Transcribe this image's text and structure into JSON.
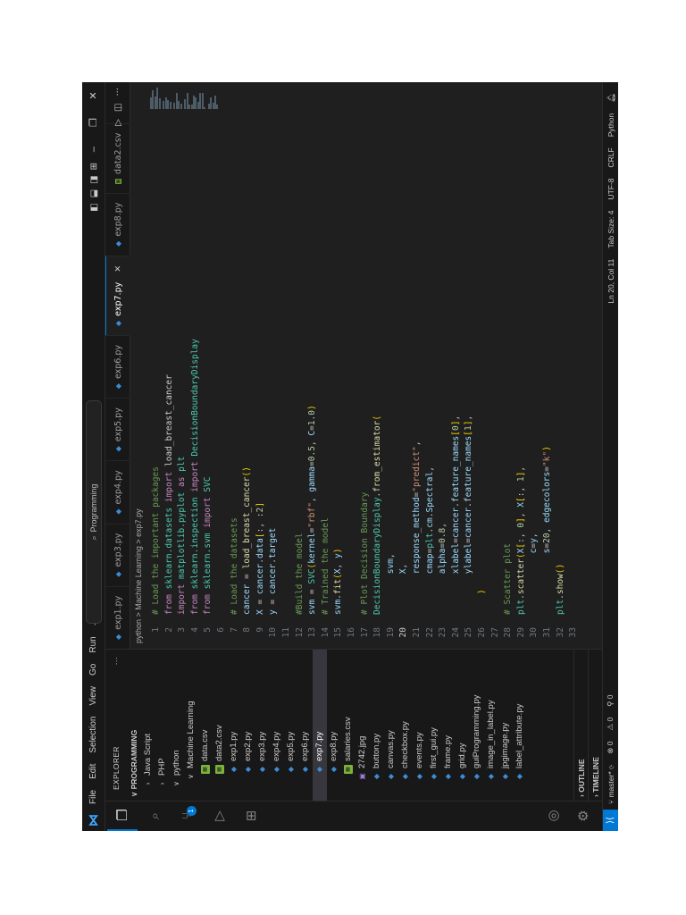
{
  "app": {
    "menu": [
      "File",
      "Edit",
      "Selection",
      "View",
      "Go",
      "Run",
      "..."
    ],
    "search_text": "Programming",
    "colors": {
      "accent": "#0078d4",
      "background": "#1f1f1f",
      "chrome": "#181818"
    }
  },
  "activity_bar": {
    "icons": [
      "explorer-icon",
      "search-icon",
      "source-control-icon",
      "extensions-icon",
      "remote-explorer-icon",
      "accounts-icon",
      "settings-gear-icon"
    ],
    "scm_badge": "1"
  },
  "sidebar": {
    "header": "EXPLORER",
    "folder": "PROGRAMMING",
    "items": [
      {
        "label": "Java Script",
        "type": "folder-closed",
        "indent": 1
      },
      {
        "label": "PHP",
        "type": "folder-closed",
        "indent": 1
      },
      {
        "label": "python",
        "type": "folder-open",
        "indent": 1
      },
      {
        "label": "Machine Learning",
        "type": "folder-open",
        "indent": 2
      },
      {
        "label": "data.csv",
        "type": "csv",
        "indent": 3
      },
      {
        "label": "data2.csv",
        "type": "csv",
        "indent": 3
      },
      {
        "label": "exp1.py",
        "type": "py",
        "indent": 3
      },
      {
        "label": "exp2.py",
        "type": "py",
        "indent": 3
      },
      {
        "label": "exp3.py",
        "type": "py",
        "indent": 3
      },
      {
        "label": "exp4.py",
        "type": "py",
        "indent": 3
      },
      {
        "label": "exp5.py",
        "type": "py",
        "indent": 3
      },
      {
        "label": "exp6.py",
        "type": "py",
        "indent": 3
      },
      {
        "label": "exp7.py",
        "type": "py",
        "indent": 3,
        "selected": true
      },
      {
        "label": "exp8.py",
        "type": "py",
        "indent": 3
      },
      {
        "label": "salaries.csv",
        "type": "csv",
        "indent": 3
      },
      {
        "label": "2742.jpg",
        "type": "jpg",
        "indent": 2
      },
      {
        "label": "button.py",
        "type": "py",
        "indent": 2
      },
      {
        "label": "canvas.py",
        "type": "py",
        "indent": 2
      },
      {
        "label": "checkbox.py",
        "type": "py",
        "indent": 2
      },
      {
        "label": "events.py",
        "type": "py",
        "indent": 2
      },
      {
        "label": "first_gui.py",
        "type": "py",
        "indent": 2
      },
      {
        "label": "frame.py",
        "type": "py",
        "indent": 2
      },
      {
        "label": "grid.py",
        "type": "py",
        "indent": 2
      },
      {
        "label": "guiProgramming.py",
        "type": "py",
        "indent": 2
      },
      {
        "label": "image_in_label.py",
        "type": "py",
        "indent": 2
      },
      {
        "label": "jpgimage.py",
        "type": "py",
        "indent": 2
      },
      {
        "label": "label_attribute.py",
        "type": "py",
        "indent": 2
      }
    ],
    "outline": "OUTLINE",
    "timeline": "TIMELINE"
  },
  "tabs": [
    {
      "label": "exp1.py",
      "active": false
    },
    {
      "label": "exp3.py",
      "active": false
    },
    {
      "label": "exp4.py",
      "active": false
    },
    {
      "label": "exp5.py",
      "active": false
    },
    {
      "label": "exp6.py",
      "active": false
    },
    {
      "label": "exp7.py",
      "active": true
    },
    {
      "label": "exp8.py",
      "active": false
    },
    {
      "label": "data2.csv",
      "active": false
    }
  ],
  "breadcrumb": "python > Machine Learning > exp7.py",
  "editor": {
    "current_line": 20,
    "lines": [
      [
        [
          "cmt",
          "# Load the important packages"
        ]
      ],
      [
        [
          "kw",
          "from "
        ],
        [
          "mod",
          "sklearn.datasets"
        ],
        [
          "kw",
          " import "
        ],
        [
          "p",
          "load_breast_cancer"
        ]
      ],
      [
        [
          "kw",
          "import "
        ],
        [
          "mod",
          "matplotlib.pyplot"
        ],
        [
          "kw",
          " as "
        ],
        [
          "mod",
          "plt"
        ]
      ],
      [
        [
          "kw",
          "from "
        ],
        [
          "mod",
          "sklearn.inspection"
        ],
        [
          "kw",
          " import "
        ],
        [
          "mod",
          "DecisionBoundaryDisplay"
        ]
      ],
      [
        [
          "kw",
          "from "
        ],
        [
          "mod",
          "sklearn.svm"
        ],
        [
          "kw",
          " import "
        ],
        [
          "mod",
          "SVC"
        ]
      ],
      [],
      [
        [
          "cmt",
          "# Load the datasets"
        ]
      ],
      [
        [
          "var",
          "cancer"
        ],
        [
          "p",
          " = "
        ],
        [
          "fn",
          "load_breast_cancer"
        ],
        [
          "br",
          "()"
        ]
      ],
      [
        [
          "var",
          "X"
        ],
        [
          "p",
          " = "
        ],
        [
          "var",
          "cancer"
        ],
        [
          "p",
          "."
        ],
        [
          "var",
          "data"
        ],
        [
          "br",
          "["
        ],
        [
          "p",
          ":, :"
        ],
        [
          "num",
          "2"
        ],
        [
          "br",
          "]"
        ]
      ],
      [
        [
          "var",
          "y"
        ],
        [
          "p",
          " = "
        ],
        [
          "var",
          "cancer"
        ],
        [
          "p",
          "."
        ],
        [
          "var",
          "target"
        ]
      ],
      [],
      [
        [
          "cmt",
          "#Build the model"
        ]
      ],
      [
        [
          "var",
          "svm"
        ],
        [
          "p",
          " = "
        ],
        [
          "mod",
          "SVC"
        ],
        [
          "br",
          "("
        ],
        [
          "var",
          "kernel"
        ],
        [
          "p",
          "="
        ],
        [
          "str",
          "\"rbf\""
        ],
        [
          "p",
          ", "
        ],
        [
          "var",
          "gamma"
        ],
        [
          "p",
          "="
        ],
        [
          "num",
          "0.5"
        ],
        [
          "p",
          ", "
        ],
        [
          "var",
          "C"
        ],
        [
          "p",
          "="
        ],
        [
          "num",
          "1.0"
        ],
        [
          "br",
          ")"
        ]
      ],
      [
        [
          "cmt",
          "# Trained the model"
        ]
      ],
      [
        [
          "var",
          "svm"
        ],
        [
          "p",
          "."
        ],
        [
          "fn",
          "fit"
        ],
        [
          "br",
          "("
        ],
        [
          "var",
          "X"
        ],
        [
          "p",
          ", "
        ],
        [
          "var",
          "y"
        ],
        [
          "br",
          ")"
        ]
      ],
      [],
      [
        [
          "cmt",
          "# Plot Decision Boundary"
        ]
      ],
      [
        [
          "mod",
          "DecisionBoundaryDisplay"
        ],
        [
          "p",
          "."
        ],
        [
          "fn",
          "from_estimator"
        ],
        [
          "br",
          "("
        ]
      ],
      [
        [
          "p",
          "        "
        ],
        [
          "var",
          "svm"
        ],
        [
          "p",
          ","
        ]
      ],
      [
        [
          "p",
          "        "
        ],
        [
          "var",
          "X"
        ],
        [
          "p",
          ","
        ]
      ],
      [
        [
          "p",
          "        "
        ],
        [
          "var",
          "response_method"
        ],
        [
          "p",
          "="
        ],
        [
          "str",
          "\"predict\""
        ],
        [
          "p",
          ","
        ]
      ],
      [
        [
          "p",
          "        "
        ],
        [
          "var",
          "cmap"
        ],
        [
          "p",
          "="
        ],
        [
          "mod",
          "plt"
        ],
        [
          "p",
          "."
        ],
        [
          "var",
          "cm"
        ],
        [
          "p",
          "."
        ],
        [
          "var",
          "Spectral"
        ],
        [
          "p",
          ","
        ]
      ],
      [
        [
          "p",
          "        "
        ],
        [
          "var",
          "alpha"
        ],
        [
          "p",
          "="
        ],
        [
          "num",
          "0.8"
        ],
        [
          "p",
          ","
        ]
      ],
      [
        [
          "p",
          "        "
        ],
        [
          "var",
          "xlabel"
        ],
        [
          "p",
          "="
        ],
        [
          "var",
          "cancer"
        ],
        [
          "p",
          "."
        ],
        [
          "var",
          "feature_names"
        ],
        [
          "br",
          "["
        ],
        [
          "num",
          "0"
        ],
        [
          "br",
          "]"
        ],
        [
          "p",
          ","
        ]
      ],
      [
        [
          "p",
          "        "
        ],
        [
          "var",
          "ylabel"
        ],
        [
          "p",
          "="
        ],
        [
          "var",
          "cancer"
        ],
        [
          "p",
          "."
        ],
        [
          "var",
          "feature_names"
        ],
        [
          "br",
          "["
        ],
        [
          "num",
          "1"
        ],
        [
          "br",
          "]"
        ],
        [
          "p",
          ","
        ]
      ],
      [
        [
          "p",
          "    "
        ],
        [
          "br",
          ")"
        ]
      ],
      [],
      [
        [
          "cmt",
          "# Scatter plot"
        ]
      ],
      [
        [
          "mod",
          "plt"
        ],
        [
          "p",
          "."
        ],
        [
          "fn",
          "scatter"
        ],
        [
          "br",
          "("
        ],
        [
          "var",
          "X"
        ],
        [
          "br",
          "["
        ],
        [
          "p",
          ":, "
        ],
        [
          "num",
          "0"
        ],
        [
          "br",
          "]"
        ],
        [
          "p",
          ", "
        ],
        [
          "var",
          "X"
        ],
        [
          "br",
          "["
        ],
        [
          "p",
          ":, "
        ],
        [
          "num",
          "1"
        ],
        [
          "br",
          "]"
        ],
        [
          "p",
          ","
        ]
      ],
      [
        [
          "p",
          "            "
        ],
        [
          "var",
          "c"
        ],
        [
          "p",
          "="
        ],
        [
          "var",
          "y"
        ],
        [
          "p",
          ","
        ]
      ],
      [
        [
          "p",
          "            "
        ],
        [
          "var",
          "s"
        ],
        [
          "p",
          "="
        ],
        [
          "num",
          "20"
        ],
        [
          "p",
          ", "
        ],
        [
          "var",
          "edgecolors"
        ],
        [
          "p",
          "="
        ],
        [
          "str",
          "\"k\""
        ],
        [
          "br",
          ")"
        ]
      ],
      [
        [
          "mod",
          "plt"
        ],
        [
          "p",
          "."
        ],
        [
          "fn",
          "show"
        ],
        [
          "br",
          "()"
        ]
      ],
      []
    ]
  },
  "status_bar": {
    "branch": "master*",
    "sync": "⟳",
    "errors": "⊗ 0",
    "warnings": "⚠ 0",
    "ports": "⚲ 0",
    "position": "Ln 20, Col 11",
    "tab_size": "Tab Size: 4",
    "encoding": "UTF-8",
    "eol": "CRLF",
    "language": "Python"
  }
}
